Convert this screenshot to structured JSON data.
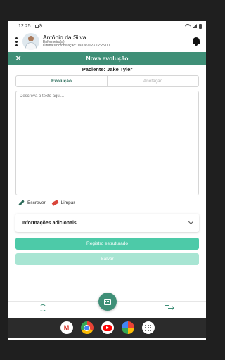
{
  "status_bar": {
    "time": "12:25"
  },
  "user": {
    "name": "Antônio da Silva",
    "role": "Enfermeiro(a)",
    "last_sync": "Última sincronização: 19/09/2023 12:25:00"
  },
  "header": {
    "title": "Nova evolução"
  },
  "patient": {
    "label": "Paciente: Jake Tyler"
  },
  "tabs": [
    {
      "label": "Evolução",
      "active": true
    },
    {
      "label": "Anotação",
      "active": false
    }
  ],
  "editor": {
    "placeholder": "Descreva o texto aqui..."
  },
  "tools": {
    "write_label": "Escrever",
    "clear_label": "Limpar"
  },
  "additional_info": {
    "label": "Informações adicionais"
  },
  "actions": {
    "structured_label": "Registro estruturado",
    "save_label": "Salvar"
  },
  "dock": {
    "apps": [
      "gmail-icon",
      "chrome-icon",
      "youtube-icon",
      "photos-icon",
      "apps-grid-icon"
    ]
  },
  "colors": {
    "header_green": "#3f8f77",
    "button_green": "#4dcaa8",
    "button_disabled": "#a8e5d3",
    "eraser_red": "#d9463a"
  }
}
